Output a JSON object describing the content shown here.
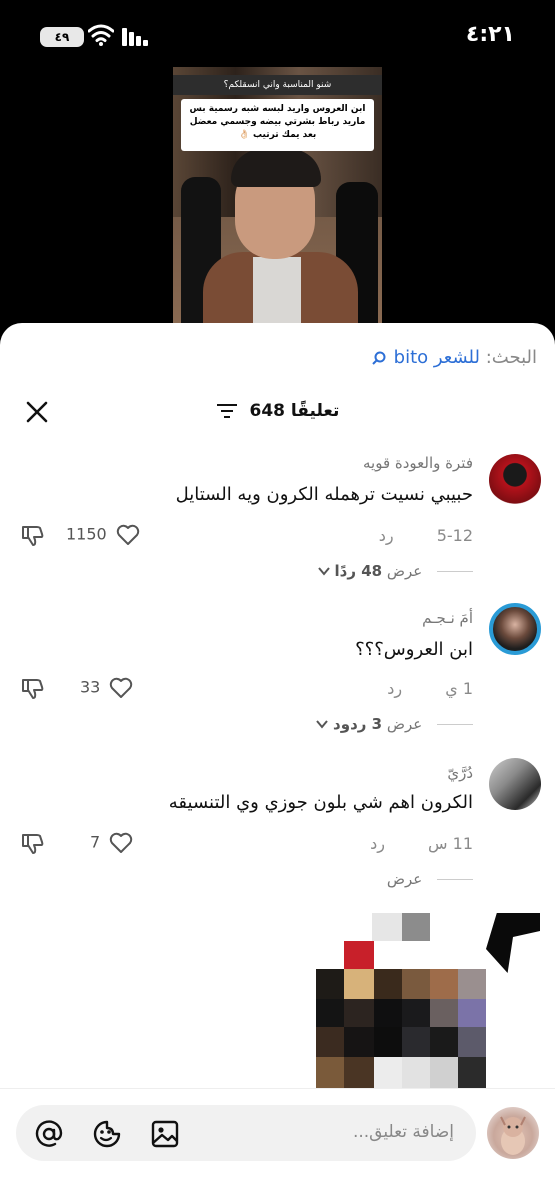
{
  "status_bar": {
    "time": "٤:٢١",
    "battery": "٤٩"
  },
  "video": {
    "question": "شنو المناسبة واني انسقلكم؟",
    "caption": "ابن العروس واريد لبسه شبه رسمية بس ماريد رباط بشرتي بيضه وجسمي معضل بعد يمك ترتيب 👌🏻"
  },
  "search": {
    "label": "البحث:",
    "term": "للشعر bito"
  },
  "header": {
    "comment_count": "648 تعليقًا"
  },
  "comments": [
    {
      "username": "فترة والعودة قويه",
      "text": "حبيبي نسيت ترهمله الكرون ويه الستايل",
      "time": "5-12",
      "reply_label": "رد",
      "likes": "1150",
      "view_replies": "عرض",
      "view_count": "48 ردًا"
    },
    {
      "username": "أمَ نـجـم",
      "text": "ابن العروس؟؟؟",
      "time": "1 ي",
      "reply_label": "رد",
      "likes": "33",
      "view_replies": "عرض",
      "view_count": "3 ردود"
    },
    {
      "username": "دُرَّيّ",
      "text": "الكرون اهم شي بلون جوزي وي التنسيقه",
      "time": "11 س",
      "reply_label": "رد",
      "likes": "7",
      "view_replies": "عرض",
      "view_count": ""
    }
  ],
  "input": {
    "placeholder": "إضافة تعليق..."
  },
  "icons": [
    "close-icon",
    "filter-icon",
    "search-icon",
    "heart-icon",
    "dislike-icon",
    "chevron-down-icon",
    "at-icon",
    "emoji-icon",
    "image-icon"
  ],
  "colors": {
    "accent": "#2d6fd6",
    "sheet": "#ffffff",
    "background": "#000000"
  }
}
